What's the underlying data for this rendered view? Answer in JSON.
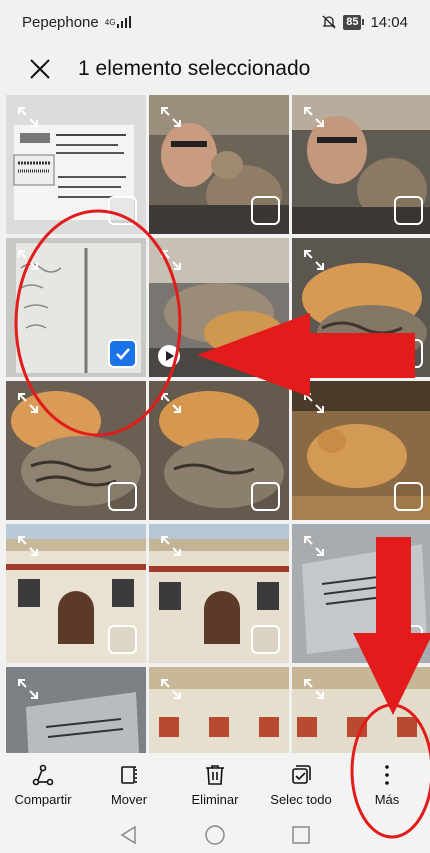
{
  "status_bar": {
    "carrier": "Pepephone",
    "network": "4G",
    "battery": "85",
    "time": "14:04"
  },
  "header": {
    "title": "1 elemento seleccionado",
    "close_icon": "close-icon"
  },
  "photos": [
    {
      "content": "router-label",
      "selected": false
    },
    {
      "content": "man-with-cat",
      "selected": false
    },
    {
      "content": "man-with-cat",
      "selected": false
    },
    {
      "content": "whiteboard",
      "selected": true
    },
    {
      "content": "cats-on-sofa",
      "selected": false,
      "video": true
    },
    {
      "content": "cats-sleeping",
      "selected": false
    },
    {
      "content": "cats-sleeping",
      "selected": false
    },
    {
      "content": "cats-sleeping",
      "selected": false
    },
    {
      "content": "cat-on-chair",
      "selected": false
    },
    {
      "content": "building",
      "selected": false
    },
    {
      "content": "building",
      "selected": false
    },
    {
      "content": "plaque",
      "selected": false
    },
    {
      "content": "plaque",
      "selected": false
    },
    {
      "content": "building-top",
      "selected": false
    },
    {
      "content": "building-top",
      "selected": false
    }
  ],
  "toolbar": {
    "share": "Compartir",
    "move": "Mover",
    "delete": "Eliminar",
    "select_all": "Selec todo",
    "more": "Más"
  },
  "colors": {
    "accent": "#1a73e8",
    "annotation": "#e31b1b"
  }
}
